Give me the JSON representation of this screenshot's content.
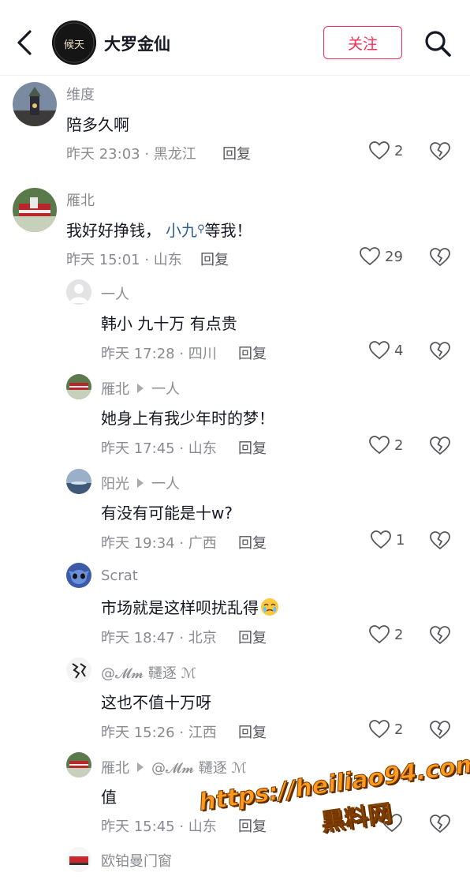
{
  "header": {
    "name": "大罗金仙",
    "avatar_text": "侯天時勢而爲",
    "follow_label": "关注"
  },
  "comments": [
    {
      "user": "维度",
      "text": "陪多久啊",
      "meta": "昨天 23:03 · 黑龙江",
      "reply": "回复",
      "likes": "2"
    },
    {
      "user": "雁北",
      "text": "我好好挣钱，",
      "mention": "小九",
      "text_after": "等我！",
      "meta": "昨天 15:01 · 山东",
      "reply": "回复",
      "likes": "29"
    }
  ],
  "replies": [
    {
      "user": "一人",
      "text": "韩小 九十万 有点贵",
      "meta": "昨天 17:28 · 四川",
      "reply": "回复",
      "likes": "4"
    },
    {
      "user": "雁北",
      "to": "一人",
      "text": "她身上有我少年时的梦！",
      "meta": "昨天 17:45 · 山东",
      "reply": "回复",
      "likes": "2"
    },
    {
      "user": "阳光",
      "to": "一人",
      "text": "有没有可能是十w?",
      "meta": "昨天 19:34 · 广西",
      "reply": "回复",
      "likes": "1"
    },
    {
      "user": "Scrat",
      "text": "市场就是这样呗扰乱得",
      "meta": "昨天 18:47 · 北京",
      "reply": "回复",
      "likes": "2"
    },
    {
      "user": "@𝓜𝓶 韆逐 ℳ",
      "text": "这也不值十万呀",
      "meta": "昨天 15:26 · 江西",
      "reply": "回复",
      "likes": "2"
    },
    {
      "user": "雁北",
      "to": "@𝓜𝓶 韆逐 ℳ",
      "text": "值",
      "meta": "昨天 15:45 · 山东",
      "reply": "回复",
      "likes": ""
    },
    {
      "user": "欧铂曼门窗"
    }
  ],
  "watermark": {
    "url": "https://heiliao94.com",
    "cn": "黑料网"
  },
  "colors": {
    "accent": "#fe2c55",
    "mention": "#2b5d9a",
    "meta": "#8a8b91"
  },
  "icons": [
    "back-arrow-icon",
    "search-icon",
    "heart-icon",
    "broken-heart-icon",
    "reply-arrow-icon"
  ]
}
